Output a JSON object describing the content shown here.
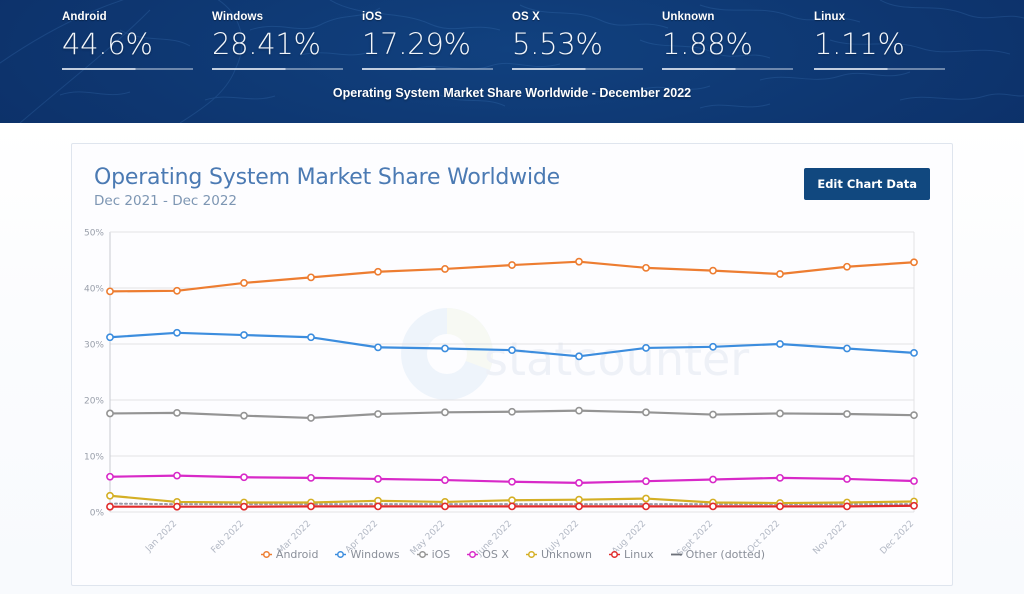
{
  "header": {
    "caption": "Operating System Market Share Worldwide - December 2022",
    "stats": [
      {
        "label": "Android",
        "value": "44.6%"
      },
      {
        "label": "Windows",
        "value": "28.41%"
      },
      {
        "label": "iOS",
        "value": "17.29%"
      },
      {
        "label": "OS X",
        "value": "5.53%"
      },
      {
        "label": "Unknown",
        "value": "1.88%"
      },
      {
        "label": "Linux",
        "value": "1.11%"
      }
    ]
  },
  "card": {
    "title": "Operating System Market Share Worldwide",
    "subtitle": "Dec 2021 - Dec 2022",
    "edit_button": "Edit Chart Data",
    "watermark": "statcounter"
  },
  "chart_data": {
    "type": "line",
    "title": "Operating System Market Share Worldwide",
    "subtitle": "Dec 2021 - Dec 2022",
    "xlabel": "",
    "ylabel": "",
    "ylim": [
      0,
      50
    ],
    "yticks": [
      "0%",
      "10%",
      "20%",
      "30%",
      "40%",
      "50%"
    ],
    "ytick_values": [
      0,
      10,
      20,
      30,
      40,
      50
    ],
    "grid": true,
    "legend_position": "bottom",
    "categories": [
      "Dec 2021",
      "Jan 2022",
      "Feb 2022",
      "Mar 2022",
      "Apr 2022",
      "May 2022",
      "June 2022",
      "July 2022",
      "Aug 2022",
      "Sept 2022",
      "Oct 2022",
      "Nov 2022",
      "Dec 2022"
    ],
    "xtick_labels": [
      "",
      "Jan 2022",
      "Feb 2022",
      "Mar 2022",
      "Apr 2022",
      "May 2022",
      "June 2022",
      "July 2022",
      "Aug 2022",
      "Sept 2022",
      "Oct 2022",
      "Nov 2022",
      "Dec 2022"
    ],
    "series": [
      {
        "name": "Android",
        "color": "#ED7D31",
        "style": "solid",
        "values": [
          39.4,
          39.5,
          40.9,
          41.9,
          42.9,
          43.4,
          44.1,
          44.7,
          43.6,
          43.1,
          42.5,
          43.8,
          44.6
        ]
      },
      {
        "name": "Windows",
        "color": "#3C8DDE",
        "style": "solid",
        "values": [
          31.2,
          32.0,
          31.6,
          31.2,
          29.4,
          29.2,
          28.9,
          27.8,
          29.3,
          29.5,
          30.0,
          29.2,
          28.41
        ]
      },
      {
        "name": "iOS",
        "color": "#949494",
        "style": "solid",
        "values": [
          17.6,
          17.7,
          17.2,
          16.8,
          17.5,
          17.8,
          17.9,
          18.1,
          17.8,
          17.4,
          17.6,
          17.5,
          17.29
        ]
      },
      {
        "name": "OS X",
        "color": "#D829C8",
        "style": "solid",
        "values": [
          6.3,
          6.5,
          6.2,
          6.1,
          5.9,
          5.7,
          5.4,
          5.2,
          5.5,
          5.8,
          6.1,
          5.9,
          5.53
        ]
      },
      {
        "name": "Unknown",
        "color": "#D4AF25",
        "style": "solid",
        "values": [
          2.9,
          1.8,
          1.7,
          1.7,
          2.0,
          1.8,
          2.1,
          2.2,
          2.4,
          1.7,
          1.6,
          1.7,
          1.88
        ]
      },
      {
        "name": "Linux",
        "color": "#E02B2B",
        "style": "solid",
        "values": [
          0.95,
          0.95,
          0.95,
          1.0,
          1.0,
          1.0,
          1.0,
          1.0,
          1.0,
          1.0,
          1.0,
          1.0,
          1.11
        ]
      },
      {
        "name": "Other (dotted)",
        "color": "#9a9aa8",
        "style": "dotted",
        "values": [
          1.5,
          1.4,
          1.4,
          1.4,
          1.4,
          1.4,
          1.4,
          1.4,
          1.4,
          1.4,
          1.4,
          1.4,
          1.4
        ]
      }
    ]
  }
}
